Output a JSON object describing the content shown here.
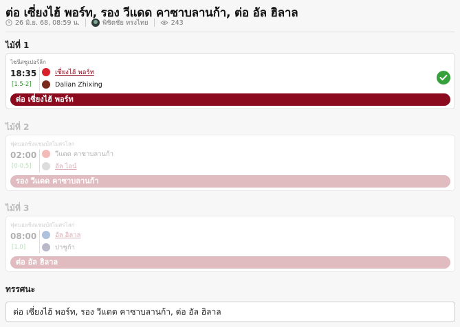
{
  "article": {
    "title": "ต่อ เซี่ยงไฮ้ พอร์ท, รอง วีแดด คาซาบลานก้า, ต่อ อัล ฮิลาล",
    "date": "26 มิ.ย. 68, 08:59 น.",
    "author": "พิชิตชัย ทรงไทย",
    "views": "243"
  },
  "picks": [
    {
      "label": "ไม้ที่ 1",
      "league": "ไชนีสซูเปอร์ลีก",
      "time": "18:35",
      "handicap": "[1.5-2]",
      "home": {
        "name": "เซี่ยงไฮ้ พอร์ท",
        "logo_color": "#d8202a"
      },
      "away": {
        "name": "Dalian Zhixing",
        "logo_color": "#7a2a1a"
      },
      "pick": "ต่อ เซี่ยงไฮ้ พอร์ท",
      "picked_side": "home",
      "status": "win"
    },
    {
      "label": "ไม้ที่ 2",
      "league": "ฟุตบอลชิงแชมป์สโมสรโลก",
      "time": "02:00",
      "handicap": "[0-0.5]",
      "home": {
        "name": "วีแดด คาซาบลานก้า",
        "logo_color": "#e23a3a"
      },
      "away": {
        "name": "อัล ไอน์",
        "logo_color": "#a0a0a0"
      },
      "pick": "รอง วีแดด คาซาบลานก้า",
      "picked_side": "away",
      "status": "pending"
    },
    {
      "label": "ไม้ที่ 3",
      "league": "ฟุตบอลชิงแชมป์สโมสรโลก",
      "time": "08:00",
      "handicap": "[1.0]",
      "home": {
        "name": "อัล ฮิลาล",
        "logo_color": "#1a4fa0"
      },
      "away": {
        "name": "ปาชูก้า",
        "logo_color": "#3a3a6a"
      },
      "pick": "ต่อ อัล ฮิลาล",
      "picked_side": "home",
      "status": "pending"
    }
  ],
  "verdict": {
    "label": "ทรรศนะ",
    "text": "ต่อ เซี่ยงไฮ้ พอร์ท, รอง วีแดด คาซาบลานก้า, ต่อ อัล ฮิลาล"
  },
  "colors": {
    "pick_bar": "#8b0a1e",
    "pick_bar_faded": "#e0bcc0",
    "handicap": "#2f9e2f",
    "check": "#36a13b"
  }
}
